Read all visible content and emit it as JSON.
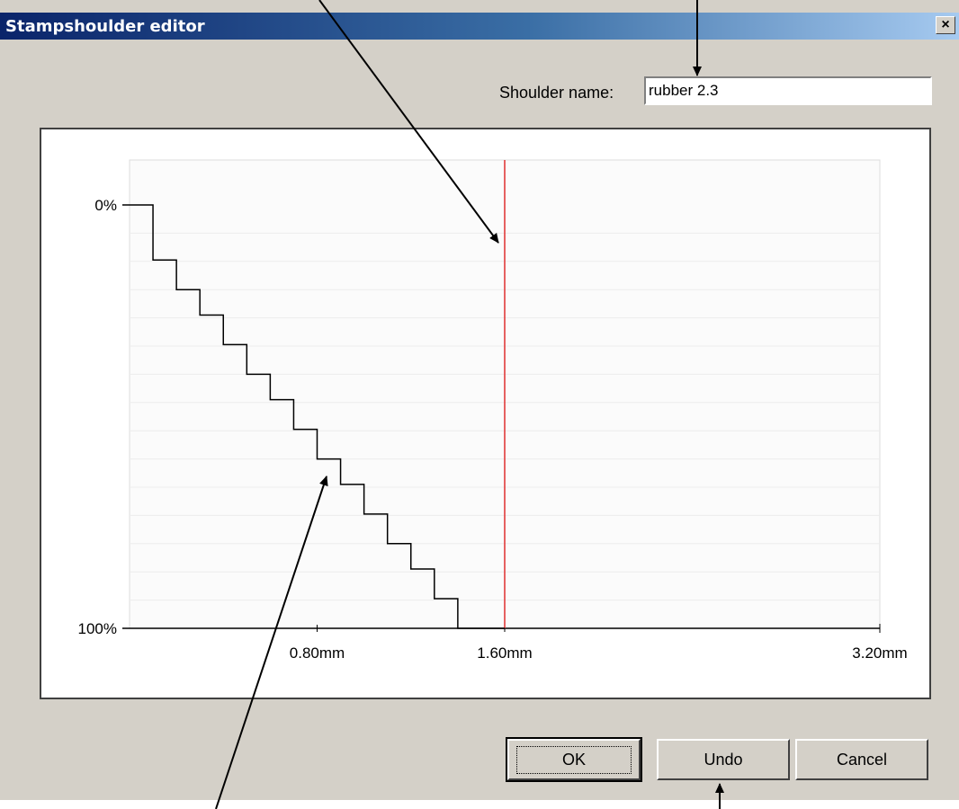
{
  "window": {
    "title": "Stampshoulder editor",
    "close_glyph": "×",
    "close_icon": "close-icon"
  },
  "shoulder": {
    "label": "Shoulder name:",
    "value": "rubber 2.3"
  },
  "buttons": {
    "ok": "OK",
    "undo": "Undo",
    "cancel": "Cancel"
  },
  "colors": {
    "titlebar_start": "#0a246a",
    "titlebar_end": "#a6caf0",
    "marker_line": "#e03030",
    "grid_line": "#ececec",
    "dialog_bg": "#d4d0c8"
  },
  "chart_data": {
    "type": "line",
    "step": true,
    "y_ticks": [
      "0%",
      "100%"
    ],
    "x_ticks": [
      "0.80mm",
      "1.60mm",
      "3.20mm"
    ],
    "x_tick_values": [
      0.8,
      1.6,
      3.2
    ],
    "xlim": [
      0,
      3.2
    ],
    "ylim": [
      0,
      100
    ],
    "y_inverted": true,
    "grid": true,
    "marker_x": 1.6,
    "series": [
      {
        "x": [
          0.0,
          0.1,
          0.2,
          0.3,
          0.4,
          0.5,
          0.6,
          0.7,
          0.8,
          0.9,
          1.0,
          1.1,
          1.2,
          1.3,
          1.4,
          1.5
        ],
        "y": [
          0,
          13,
          20,
          26,
          33,
          40,
          46,
          53,
          60,
          66,
          73,
          80,
          86,
          93,
          100,
          100
        ]
      }
    ]
  }
}
